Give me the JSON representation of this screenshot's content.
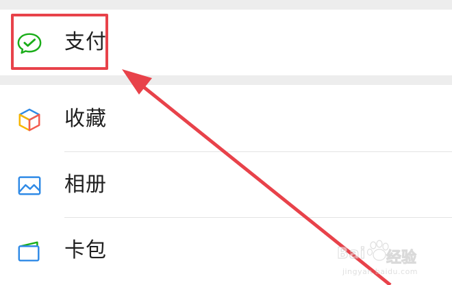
{
  "menu": {
    "items": [
      {
        "label": "支付",
        "icon": "wechat-pay-icon"
      },
      {
        "label": "收藏",
        "icon": "favorites-cube-icon"
      },
      {
        "label": "相册",
        "icon": "album-image-icon"
      },
      {
        "label": "卡包",
        "icon": "card-wallet-icon"
      }
    ]
  },
  "annotation": {
    "highlight_color": "#e8424a",
    "arrow_color": "#e8424a"
  },
  "watermark": {
    "brand": "Bai",
    "brand_cn": "经验",
    "url": "jingyan.baidu.com"
  },
  "colors": {
    "pay_green": "#1aad19",
    "section_gap": "#ededed"
  }
}
